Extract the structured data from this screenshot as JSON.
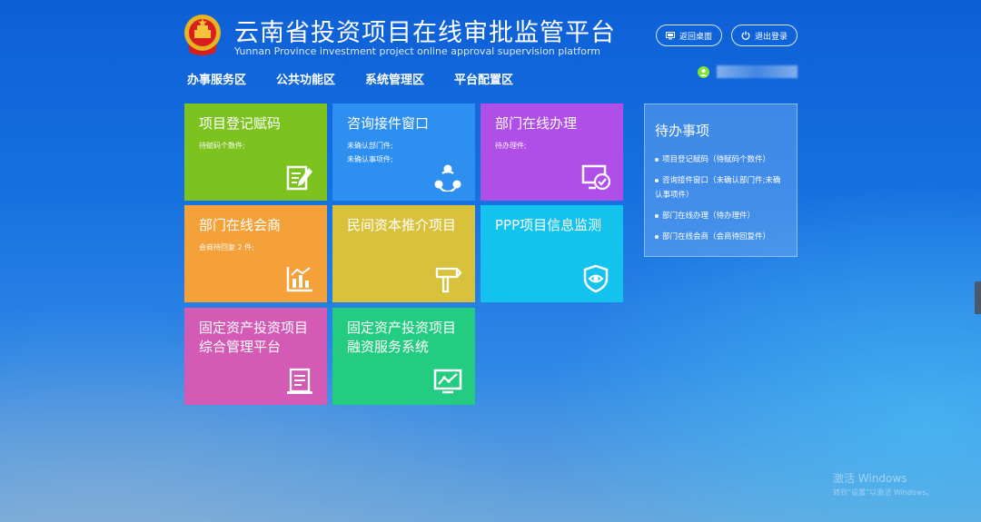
{
  "header": {
    "title_cn": "云南省投资项目在线审批监管平台",
    "title_en": "Yunnan Province investment project online approval supervision platform",
    "emblem_icon": "national-emblem-icon"
  },
  "nav": [
    {
      "label": "办事服务区"
    },
    {
      "label": "公共功能区"
    },
    {
      "label": "系统管理区"
    },
    {
      "label": "平台配置区"
    }
  ],
  "top_buttons": {
    "back_desktop": {
      "label": "返回桌面",
      "icon": "monitor-icon"
    },
    "logout": {
      "label": "退出登录",
      "icon": "power-icon"
    }
  },
  "user": {
    "icon": "user-icon",
    "name": ""
  },
  "tiles": [
    {
      "title": "项目登记赋码",
      "subs": [
        "待赋码个数件;"
      ],
      "color": "#7dc31f",
      "icon": "register-edit-icon"
    },
    {
      "title": "咨询接件窗口",
      "subs": [
        "未确认部门件;",
        "未确认事项件;"
      ],
      "color": "#2d8ff0",
      "icon": "share-nodes-icon"
    },
    {
      "title": "部门在线办理",
      "subs": [
        "待办理件;"
      ],
      "color": "#b04ee8",
      "icon": "screen-check-icon"
    },
    {
      "title": "部门在线会商",
      "subs": [
        "会商待回复 2 件;"
      ],
      "color": "#f5a13a",
      "icon": "bar-chart-icon"
    },
    {
      "title": "民间资本推介项目",
      "subs": [],
      "color": "#d8c23c",
      "icon": "signpost-icon"
    },
    {
      "title": "PPP项目信息监测",
      "subs": [],
      "color": "#14c2ee",
      "icon": "shield-eye-icon"
    },
    {
      "title": "固定资产投资项目综合管理平台",
      "subs": [],
      "color": "#d35ab5",
      "icon": "document-icon"
    },
    {
      "title": "固定资产投资项目融资服务系统",
      "subs": [],
      "color": "#23cc80",
      "icon": "line-chart-icon"
    }
  ],
  "todo": {
    "title": "待办事项",
    "items": [
      "项目登记赋码（待赋码个数件）",
      "咨询接件窗口（未确认部门件;未确认事项件）",
      "部门在线办理（待办理件）",
      "部门在线会商（会商待回复件）"
    ]
  },
  "watermark": {
    "line1": "激活 Windows",
    "line2": "转到“设置”以激活 Windows。"
  }
}
